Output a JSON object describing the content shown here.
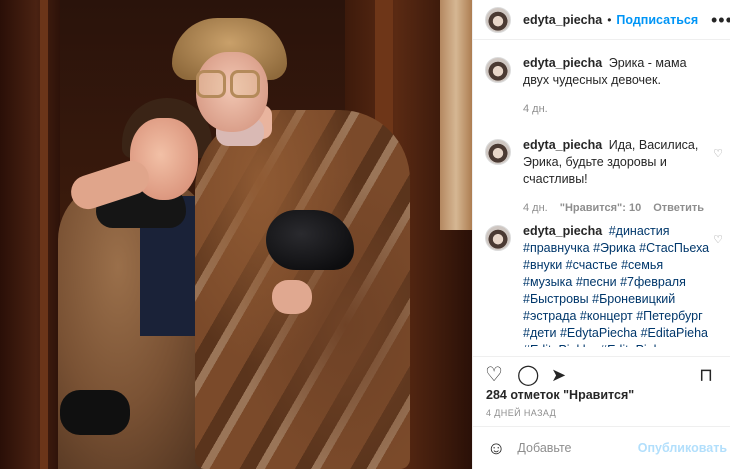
{
  "post": {
    "username": "edyta_piecha",
    "follow_label": "Подписаться",
    "more_icon": "ellipsis-icon"
  },
  "comments": [
    {
      "username": "edyta_piecha",
      "text": "Эрика - мама двух чудесных девочек.",
      "time": "4 дн."
    },
    {
      "username": "edyta_piecha",
      "text": "Ида, Василиса, Эрика, будьте здоровы и счастливы!",
      "time": "4 дн.",
      "likes": "\"Нравится\": 10",
      "reply": "Ответить"
    },
    {
      "username": "edyta_piecha",
      "text": "#династия #правнучка #Эрика #СтасПьеха #внуки #счастье #семья #музыка #песни #7февраля #Быстровы #Броневицкий #эстрада #концерт #Петербург #дети #EdytaPiecha #EditaPieha #EditaPiekha #EditaPjeha #ЭлитаПьеха #Пьеха"
    }
  ],
  "actions": {
    "like_icon": "heart-icon",
    "comment_icon": "comment-icon",
    "share_icon": "share-icon",
    "save_icon": "bookmark-icon"
  },
  "likes_text": "284 отметок \"Нравится\"",
  "date_text": "4 ДНЕЙ НАЗАД",
  "add_comment": {
    "placeholder": "Добавьте",
    "publish": "Опубликовать"
  },
  "colors": {
    "link": "#0095f6",
    "hashtag": "#00376b",
    "muted": "#8e8e8e",
    "border": "#efefef"
  }
}
